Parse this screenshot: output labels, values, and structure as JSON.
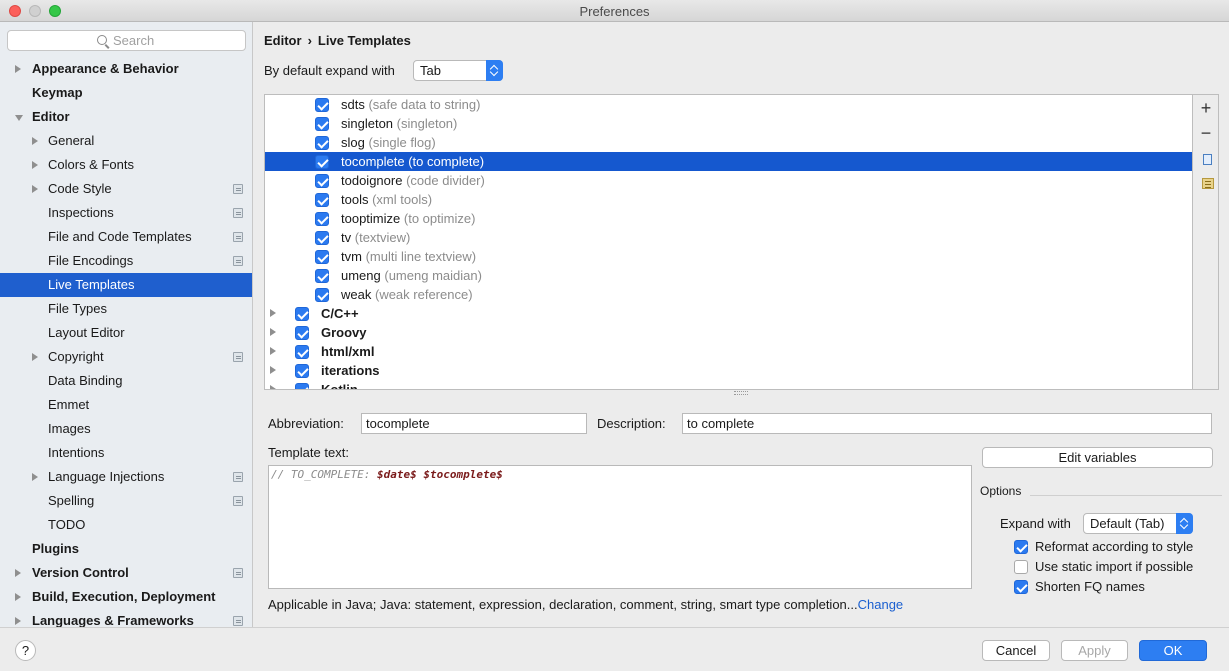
{
  "window": {
    "title": "Preferences"
  },
  "search": {
    "placeholder": "Search"
  },
  "sidebar": {
    "items": [
      {
        "label": "Appearance & Behavior",
        "level": 0,
        "bold": true,
        "arrow": "right",
        "project": false
      },
      {
        "label": "Keymap",
        "level": 0,
        "bold": true,
        "arrow": "",
        "project": false
      },
      {
        "label": "Editor",
        "level": 0,
        "bold": true,
        "arrow": "down",
        "project": false
      },
      {
        "label": "General",
        "level": 1,
        "bold": false,
        "arrow": "right",
        "project": false
      },
      {
        "label": "Colors & Fonts",
        "level": 1,
        "bold": false,
        "arrow": "right",
        "project": false
      },
      {
        "label": "Code Style",
        "level": 1,
        "bold": false,
        "arrow": "right",
        "project": true
      },
      {
        "label": "Inspections",
        "level": 1,
        "bold": false,
        "arrow": "",
        "project": true
      },
      {
        "label": "File and Code Templates",
        "level": 1,
        "bold": false,
        "arrow": "",
        "project": true
      },
      {
        "label": "File Encodings",
        "level": 1,
        "bold": false,
        "arrow": "",
        "project": true
      },
      {
        "label": "Live Templates",
        "level": 1,
        "bold": false,
        "arrow": "",
        "project": false,
        "selected": true
      },
      {
        "label": "File Types",
        "level": 1,
        "bold": false,
        "arrow": "",
        "project": false
      },
      {
        "label": "Layout Editor",
        "level": 1,
        "bold": false,
        "arrow": "",
        "project": false
      },
      {
        "label": "Copyright",
        "level": 1,
        "bold": false,
        "arrow": "right",
        "project": true
      },
      {
        "label": "Data Binding",
        "level": 1,
        "bold": false,
        "arrow": "",
        "project": false
      },
      {
        "label": "Emmet",
        "level": 1,
        "bold": false,
        "arrow": "",
        "project": false
      },
      {
        "label": "Images",
        "level": 1,
        "bold": false,
        "arrow": "",
        "project": false
      },
      {
        "label": "Intentions",
        "level": 1,
        "bold": false,
        "arrow": "",
        "project": false
      },
      {
        "label": "Language Injections",
        "level": 1,
        "bold": false,
        "arrow": "right",
        "project": true
      },
      {
        "label": "Spelling",
        "level": 1,
        "bold": false,
        "arrow": "",
        "project": true
      },
      {
        "label": "TODO",
        "level": 1,
        "bold": false,
        "arrow": "",
        "project": false
      },
      {
        "label": "Plugins",
        "level": 0,
        "bold": true,
        "arrow": "",
        "project": false
      },
      {
        "label": "Version Control",
        "level": 0,
        "bold": true,
        "arrow": "right",
        "project": true
      },
      {
        "label": "Build, Execution, Deployment",
        "level": 0,
        "bold": true,
        "arrow": "right",
        "project": false
      },
      {
        "label": "Languages & Frameworks",
        "level": 0,
        "bold": true,
        "arrow": "right",
        "project": true
      }
    ]
  },
  "breadcrumb": {
    "parent": "Editor",
    "separator": "›",
    "current": "Live Templates"
  },
  "expand": {
    "label": "By default expand with",
    "value": "Tab"
  },
  "templates": [
    {
      "abbr": "sdts",
      "desc": "(safe data to string)",
      "checked": true
    },
    {
      "abbr": "singleton",
      "desc": "(singleton)",
      "checked": true
    },
    {
      "abbr": "slog",
      "desc": "(single flog)",
      "checked": true
    },
    {
      "abbr": "tocomplete",
      "desc": "(to complete)",
      "checked": true,
      "selected": true
    },
    {
      "abbr": "todoignore",
      "desc": "(code divider)",
      "checked": true
    },
    {
      "abbr": "tools",
      "desc": "(xml tools)",
      "checked": true
    },
    {
      "abbr": "tooptimize",
      "desc": "(to optimize)",
      "checked": true
    },
    {
      "abbr": "tv",
      "desc": "(textview)",
      "checked": true
    },
    {
      "abbr": "tvm",
      "desc": "(multi line textview)",
      "checked": true
    },
    {
      "abbr": "umeng",
      "desc": "(umeng maidian)",
      "checked": true
    },
    {
      "abbr": "weak",
      "desc": "(weak reference)",
      "checked": true
    }
  ],
  "groups": [
    {
      "name": "C/C++",
      "checked": true
    },
    {
      "name": "Groovy",
      "checked": true
    },
    {
      "name": "html/xml",
      "checked": true
    },
    {
      "name": "iterations",
      "checked": true
    },
    {
      "name": "Kotlin",
      "checked": true
    }
  ],
  "tools": {
    "add": "+",
    "remove": "−"
  },
  "editor": {
    "abbreviation_label": "Abbreviation:",
    "abbreviation_value": "tocomplete",
    "description_label": "Description:",
    "description_value": "to complete",
    "template_text_label": "Template text:",
    "template_comment": "// TO_COMPLETE: ",
    "template_var1": "$date$",
    "template_space": " ",
    "template_var2": "$tocomplete$",
    "edit_variables": "Edit variables",
    "applicable_text": "Applicable in Java; Java: statement, expression, declaration, comment, string, smart type completion...",
    "applicable_link": "Change"
  },
  "options": {
    "title": "Options",
    "expand_label": "Expand with",
    "expand_value": "Default (Tab)",
    "reformat": {
      "label": "Reformat according to style",
      "checked": true
    },
    "static_import": {
      "label": "Use static import if possible",
      "checked": false
    },
    "shorten_fq": {
      "label": "Shorten FQ names",
      "checked": true
    }
  },
  "footer": {
    "help": "?",
    "cancel": "Cancel",
    "apply": "Apply",
    "ok": "OK"
  },
  "colors": {
    "selection": "#1558cf",
    "sidebar_selection": "#1f5fce",
    "accent": "#2d7ef2",
    "link": "#1a5fd0"
  }
}
